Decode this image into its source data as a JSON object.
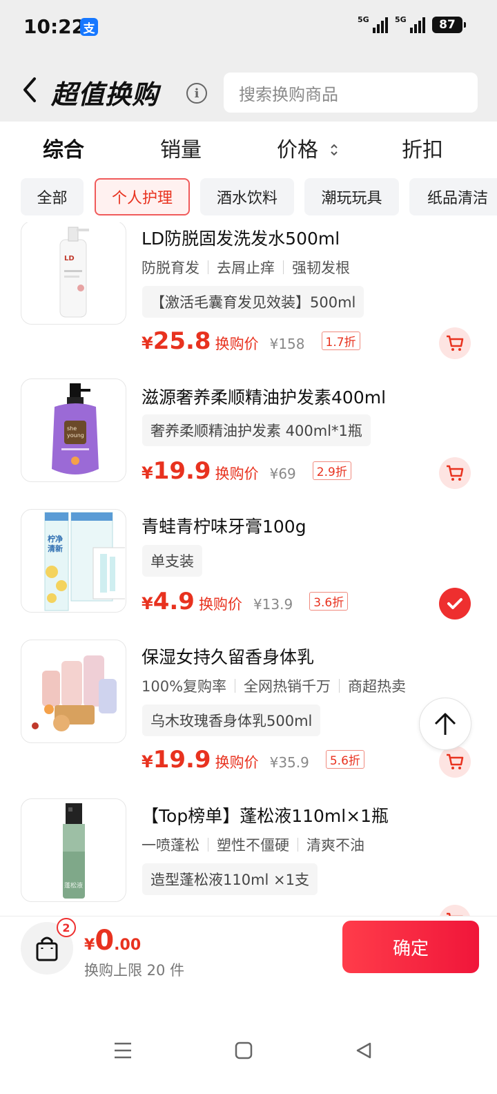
{
  "status_bar": {
    "time": "10:22",
    "app_badge": "支",
    "signal_1_label": "5G",
    "signal_2_label": "5G",
    "battery": "87"
  },
  "header": {
    "title": "超值换购",
    "search_placeholder": "搜索换购商品"
  },
  "sort_tabs": [
    {
      "label": "综合",
      "active": true
    },
    {
      "label": "销量",
      "active": false
    },
    {
      "label": "价格",
      "active": false
    },
    {
      "label": "折扣",
      "active": false
    }
  ],
  "categories": [
    {
      "label": "全部",
      "active": false
    },
    {
      "label": "个人护理",
      "active": true
    },
    {
      "label": "酒水饮料",
      "active": false
    },
    {
      "label": "潮玩玩具",
      "active": false
    },
    {
      "label": "纸品清洁",
      "active": false
    }
  ],
  "products": [
    {
      "name": "LD防脱固发洗发水500ml",
      "tags": [
        "防脱育发",
        "去屑止痒",
        "强韧发根"
      ],
      "spec": "【激活毛囊育发见效装】500ml",
      "currency": "¥",
      "price": "25.8",
      "price_tag": "换购价",
      "original_price": "¥158",
      "discount": "1.7折",
      "selected": false,
      "image_lettering": "LD"
    },
    {
      "name": "滋源奢养柔顺精油护发素400ml",
      "tags": [],
      "spec": "奢养柔顺精油护发素 400ml*1瓶",
      "currency": "¥",
      "price": "19.9",
      "price_tag": "换购价",
      "original_price": "¥69",
      "discount": "2.9折",
      "selected": false,
      "image_lettering": "she young"
    },
    {
      "name": "青蛙青柠味牙膏100g",
      "tags": [],
      "spec": "单支装",
      "currency": "¥",
      "price": "4.9",
      "price_tag": "换购价",
      "original_price": "¥13.9",
      "discount": "3.6折",
      "selected": true,
      "image_lettering": "柠净清新"
    },
    {
      "name": "保湿女持久留香身体乳",
      "tags": [
        "100%复购率",
        "全网热销千万",
        "商超热卖"
      ],
      "spec": "乌木玫瑰香身体乳500ml",
      "currency": "¥",
      "price": "19.9",
      "price_tag": "换购价",
      "original_price": "¥35.9",
      "discount": "5.6折",
      "selected": false
    },
    {
      "name": "【Top榜单】蓬松液110ml×1瓶",
      "tags": [
        "一喷蓬松",
        "塑性不僵硬",
        "清爽不油"
      ],
      "spec": "造型蓬松液110ml ×1支",
      "selected": false,
      "image_lettering": "蓬松液"
    }
  ],
  "bottom_bar": {
    "cart_count": "2",
    "currency": "¥",
    "total_int": "0",
    "total_dec": ".00",
    "limit_text": "换购上限 20 件",
    "confirm_label": "确定"
  },
  "colors": {
    "accent": "#e8321f",
    "confirm": "#f0163a",
    "background_header": "#eeeeee"
  },
  "icons": [
    "back-chevron-icon",
    "info-icon",
    "sort-arrows-icon",
    "cart-icon",
    "check-icon",
    "arrow-up-icon",
    "shopping-bag-icon",
    "menu-icon",
    "home-square-icon",
    "back-triangle-icon"
  ]
}
